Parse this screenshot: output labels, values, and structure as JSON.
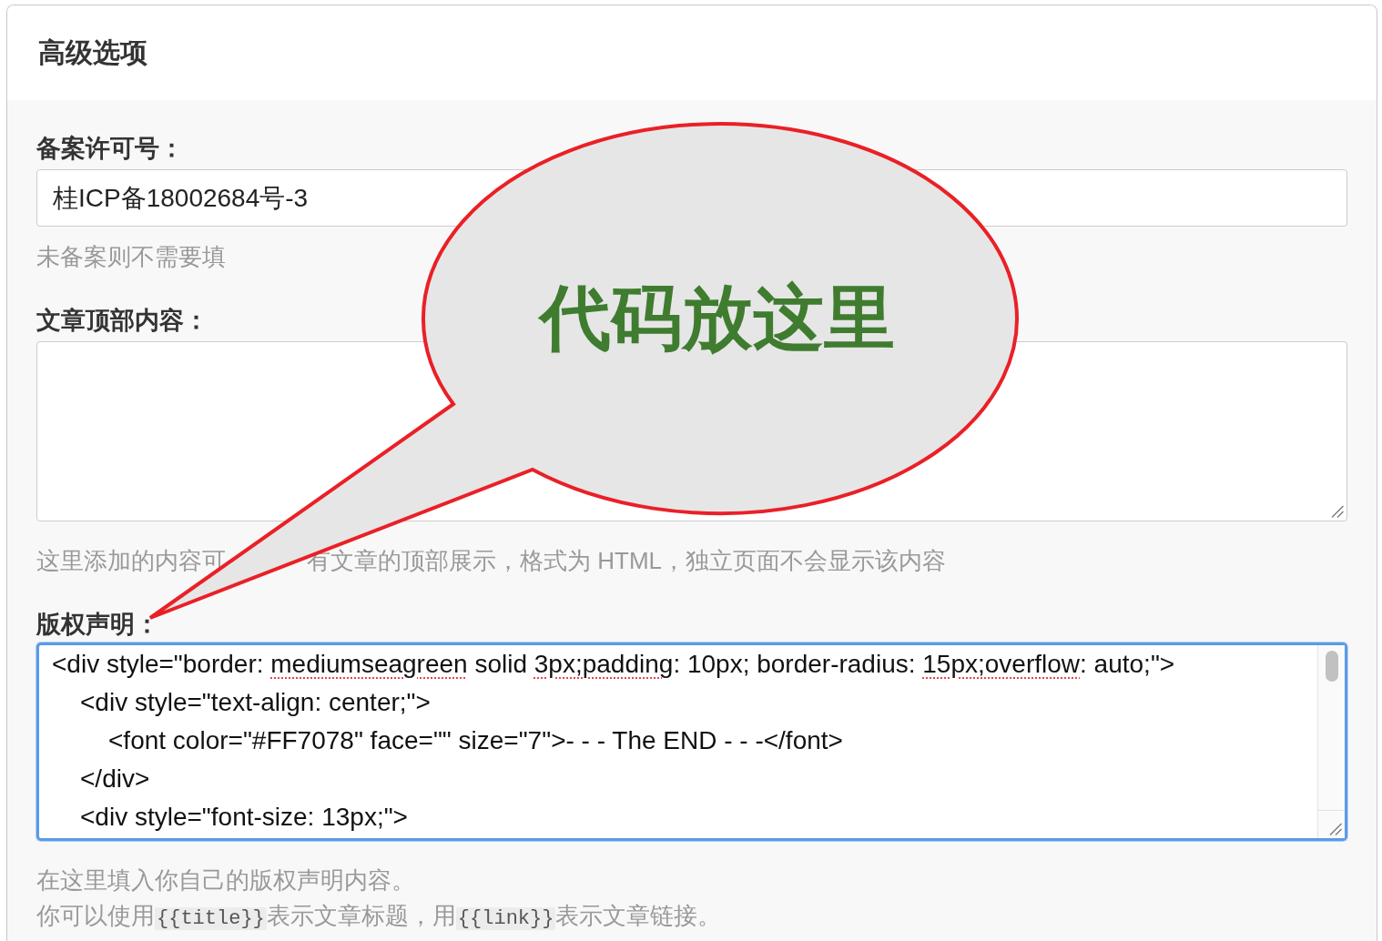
{
  "panel": {
    "title": "高级选项"
  },
  "fields": [
    {
      "kind": "input",
      "label": "备案许可号：",
      "value": "桂ICP备18002684号-3",
      "focused": false,
      "hint_lines": [
        {
          "fragments": [
            [
              {
                "kind": "plain",
                "text": "未备案则不需要填"
              }
            ]
          ]
        }
      ]
    },
    {
      "kind": "textarea",
      "label": "文章顶部内容：",
      "focused": false,
      "hint_lines": [
        {
          "fragments": [
            [
              {
                "kind": "plain",
                "text": "这里添加的内容可"
              }
            ],
            [
              {
                "kind": "plain",
                "text": "有文章的顶部展示，格式为 HTML，独立页面不会显示该内容"
              }
            ]
          ]
        }
      ]
    },
    {
      "kind": "textarea",
      "label": "版权声明：",
      "focused": true,
      "lines": [
        {
          "segments": [
            {
              "text": "<div style=\"border: ",
              "misspelled": false
            },
            {
              "text": "mediumseagreen",
              "misspelled": true
            },
            {
              "text": " solid ",
              "misspelled": false
            },
            {
              "text": "3px;padding",
              "misspelled": true
            },
            {
              "text": ": 10px; border-radius: ",
              "misspelled": false
            },
            {
              "text": "15px;overflow",
              "misspelled": true
            },
            {
              "text": ": auto;\">",
              "misspelled": false
            }
          ],
          "children": [
            {
              "segments": [
                {
                  "text": "<div style=\"text-align: center;\">",
                  "misspelled": false
                }
              ],
              "children": [
                {
                  "segments": [
                    {
                      "text": "<font color=\"#FF7078\" face=\"\" size=\"7\">- - - The END - - -</font>",
                      "misspelled": false
                    }
                  ]
                }
              ]
            },
            {
              "segments": [
                {
                  "text": "</div>",
                  "misspelled": false
                }
              ]
            },
            {
              "segments": [
                {
                  "text": "<div style=\"font-size: 13px;\">",
                  "misspelled": false
                }
              ]
            }
          ]
        }
      ],
      "hint_lines": [
        {
          "fragments": [
            [
              {
                "kind": "plain",
                "text": "在这里填入你自己的版权声明内容。"
              }
            ]
          ]
        },
        {
          "fragments": [
            [
              {
                "kind": "plain",
                "text": "你可以使用"
              },
              {
                "kind": "code",
                "text": "{{title}}"
              },
              {
                "kind": "plain",
                "text": "表示文章标题，用"
              },
              {
                "kind": "code",
                "text": "{{link}}"
              },
              {
                "kind": "plain",
                "text": "表示文章链接。"
              }
            ]
          ]
        }
      ]
    }
  ],
  "callout": {
    "text": "代码放这里"
  }
}
